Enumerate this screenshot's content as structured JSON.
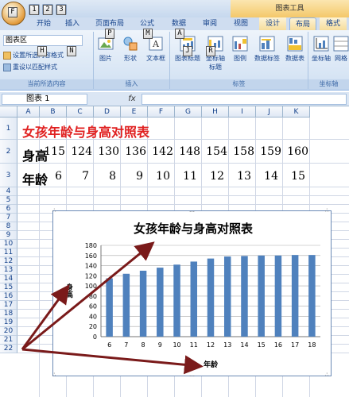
{
  "titlebar": {
    "chart_tools": "图表工具"
  },
  "keytips": [
    "F",
    "1",
    "2",
    "3",
    "H",
    "N",
    "P",
    "M",
    "A",
    "J",
    "R"
  ],
  "tabs": [
    "开始",
    "插入",
    "页面布局",
    "公式",
    "数据",
    "审阅",
    "视图",
    "设计",
    "布局",
    "格式"
  ],
  "ribbon": {
    "current_selection": {
      "label": "当前所选内容",
      "dropdown_value": "图表区",
      "format_btn": "设置所选内容格式",
      "reset_btn": "重设以匹配样式"
    },
    "insert": {
      "label": "插入",
      "picture": "图片",
      "shapes": "形状",
      "textbox": "文本框"
    },
    "labels_group": {
      "label": "标签",
      "chart_title": "图表标题",
      "axis_titles_line1": "坐标轴",
      "axis_titles_line2": "标题",
      "legend": "图例",
      "data_labels": "数据标签",
      "data_table": "数据表"
    },
    "axes_group": {
      "label": "坐标轴",
      "axes": "坐标轴",
      "gridlines": "网格"
    }
  },
  "formula_bar": {
    "name_box": "图表 1",
    "fx": "fx"
  },
  "columns": [
    "A",
    "B",
    "C",
    "D",
    "E",
    "F",
    "G",
    "H",
    "I",
    "J",
    "K"
  ],
  "rows": [
    "1",
    "2",
    "3",
    "4",
    "5",
    "6",
    "7",
    "8",
    "9",
    "10",
    "11",
    "12",
    "13",
    "14",
    "15",
    "16",
    "17",
    "18",
    "19",
    "20",
    "21",
    "22"
  ],
  "sheet": {
    "title": "女孩年龄与身高对照表",
    "height_label": "身高",
    "age_label": "年龄",
    "heights": [
      "115",
      "124",
      "130",
      "136",
      "142",
      "148",
      "154",
      "158",
      "159",
      "160"
    ],
    "ages": [
      "6",
      "7",
      "8",
      "9",
      "10",
      "11",
      "12",
      "13",
      "14",
      "15"
    ]
  },
  "chart_data": {
    "type": "bar",
    "title": "女孩年龄与身高对照表",
    "xlabel": "年龄",
    "ylabel": "身高",
    "categories": [
      "6",
      "7",
      "8",
      "9",
      "10",
      "11",
      "12",
      "13",
      "14",
      "15",
      "16",
      "17",
      "18"
    ],
    "values": [
      115,
      124,
      130,
      136,
      142,
      148,
      154,
      158,
      159,
      160,
      160,
      161,
      161
    ],
    "ylim": [
      0,
      180
    ],
    "yticks": [
      "0",
      "20",
      "40",
      "60",
      "80",
      "100",
      "120",
      "140",
      "160",
      "180"
    ],
    "grid": true,
    "bar_color": "#4f81bd"
  },
  "colors": {
    "title_red": "#e02020",
    "arrow": "#7a1a1a",
    "accent": "#4f81bd"
  }
}
